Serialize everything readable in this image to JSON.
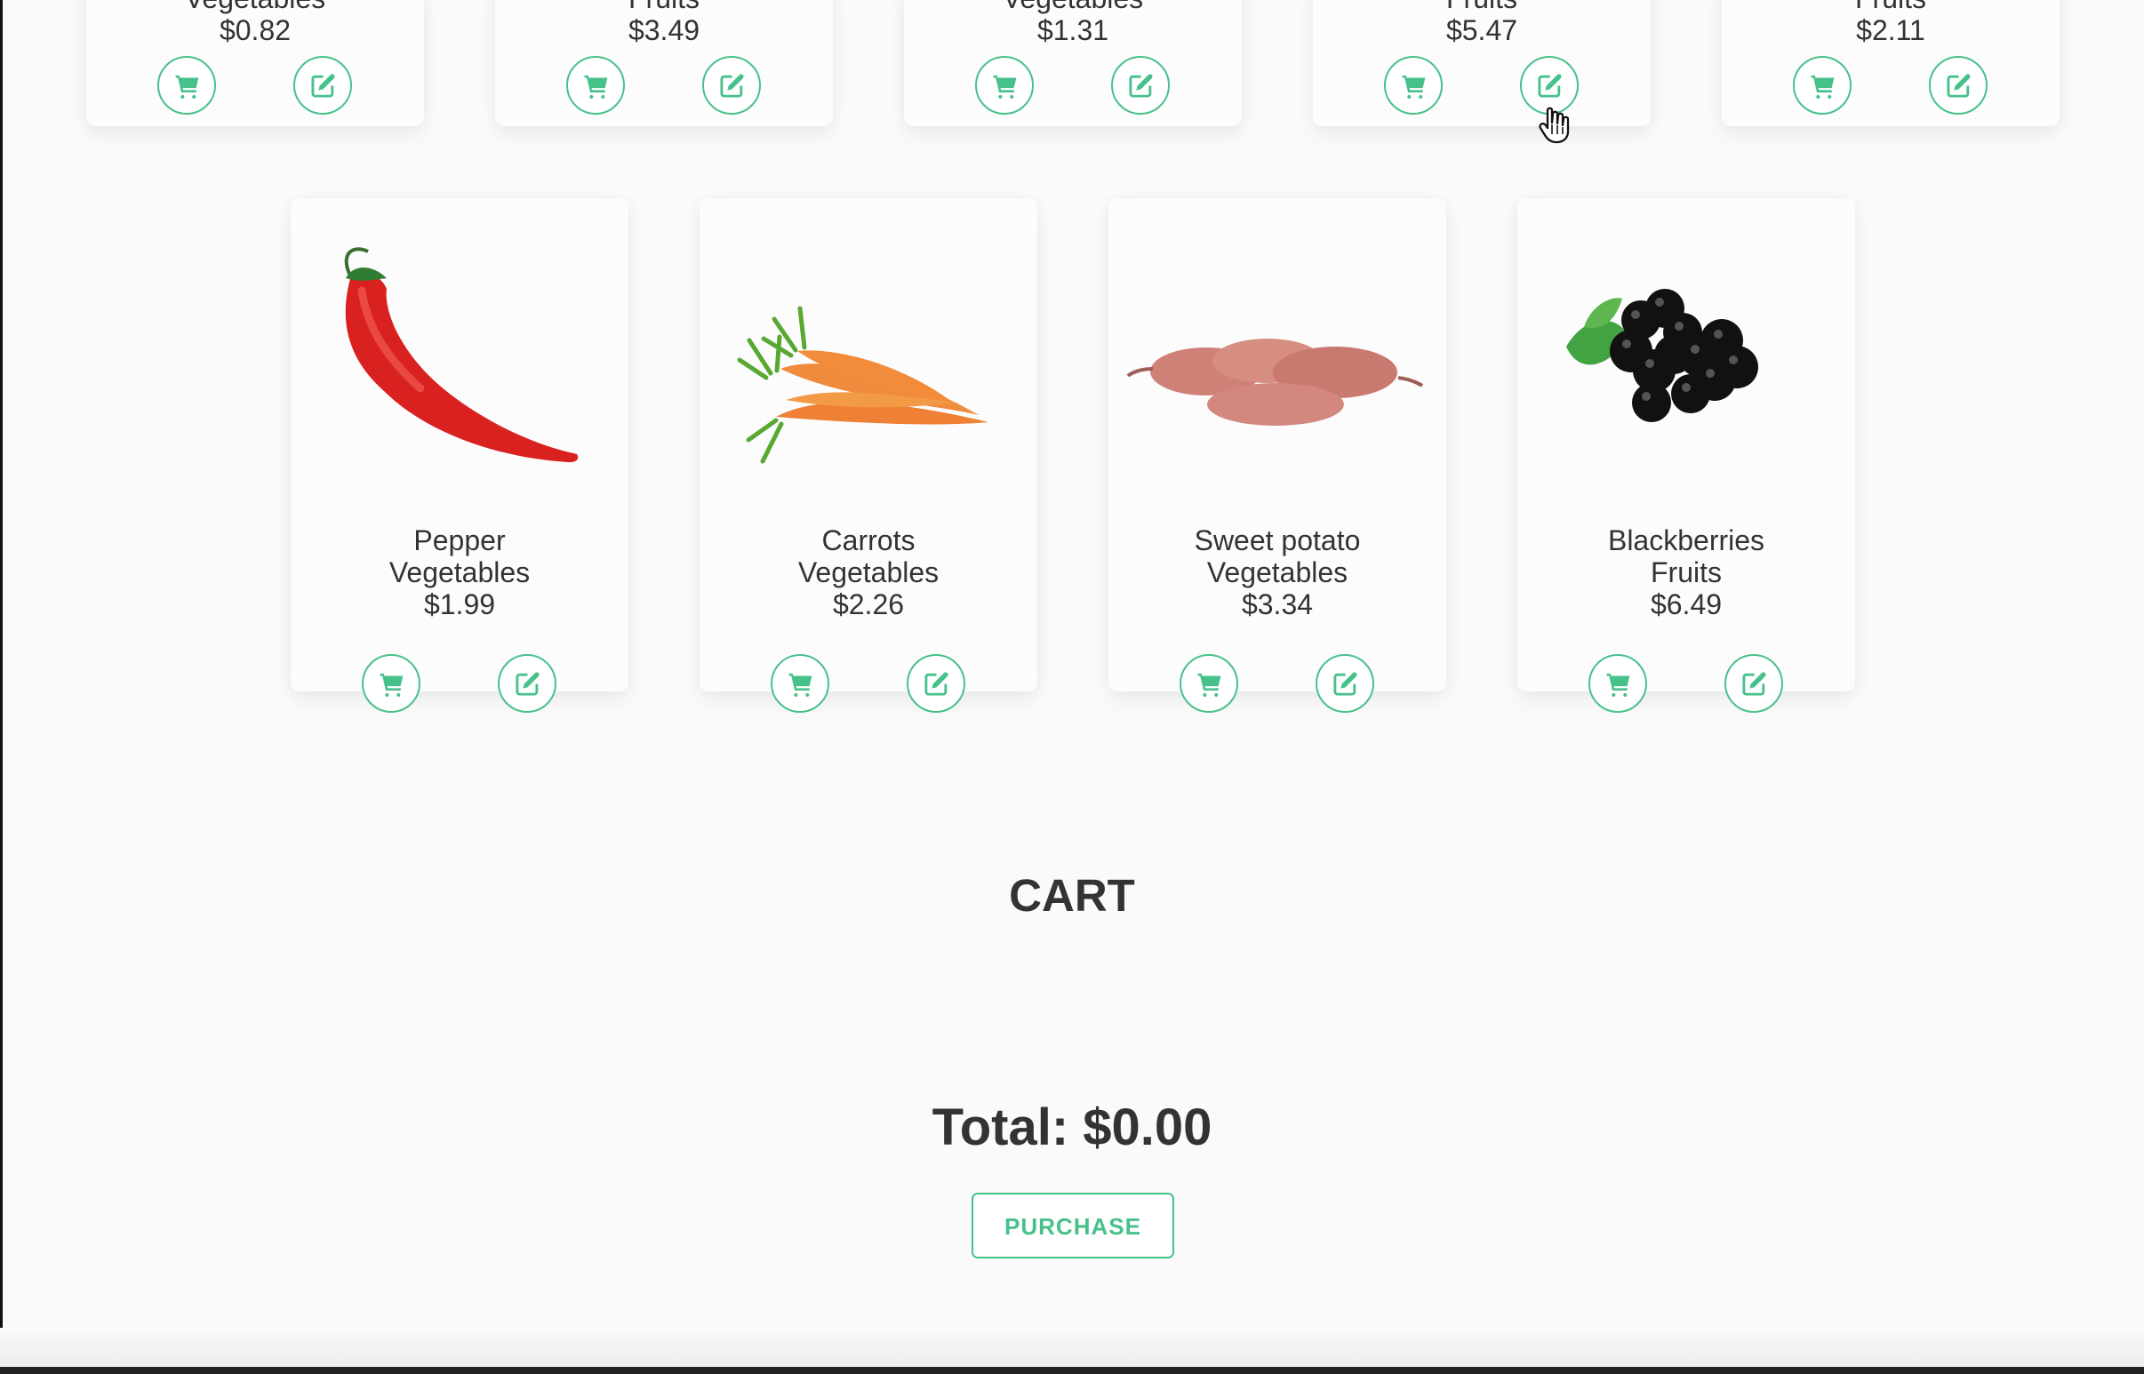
{
  "theme": {
    "accent": "#47c18a",
    "page_background": "#fafafa",
    "text": "#333333"
  },
  "top_row": [
    {
      "category": "Vegetables",
      "price": "$0.82",
      "cart_icon": "shopping-cart-icon",
      "edit_icon": "edit-icon"
    },
    {
      "category": "Fruits",
      "price": "$3.49",
      "cart_icon": "shopping-cart-icon",
      "edit_icon": "edit-icon"
    },
    {
      "category": "Vegetables",
      "price": "$1.31",
      "cart_icon": "shopping-cart-icon",
      "edit_icon": "edit-icon"
    },
    {
      "category": "Fruits",
      "price": "$5.47",
      "cart_icon": "shopping-cart-icon",
      "edit_icon": "edit-icon"
    },
    {
      "category": "Fruits",
      "price": "$2.11",
      "cart_icon": "shopping-cart-icon",
      "edit_icon": "edit-icon"
    }
  ],
  "bottom_row": [
    {
      "name": "Pepper",
      "category": "Vegetables",
      "price": "$1.99",
      "image": "red-pepper-image",
      "cart_icon": "shopping-cart-icon",
      "edit_icon": "edit-icon"
    },
    {
      "name": "Carrots",
      "category": "Vegetables",
      "price": "$2.26",
      "image": "carrots-image",
      "cart_icon": "shopping-cart-icon",
      "edit_icon": "edit-icon"
    },
    {
      "name": "Sweet potato",
      "category": "Vegetables",
      "price": "$3.34",
      "image": "sweet-potato-image",
      "cart_icon": "shopping-cart-icon",
      "edit_icon": "edit-icon"
    },
    {
      "name": "Blackberries",
      "category": "Fruits",
      "price": "$6.49",
      "image": "blackberries-image",
      "cart_icon": "shopping-cart-icon",
      "edit_icon": "edit-icon"
    }
  ],
  "cart": {
    "title": "CART",
    "total_label": "Total: $0.00",
    "purchase_label": "PURCHASE"
  },
  "pointer": {
    "icon": "hand-pointer-icon"
  }
}
